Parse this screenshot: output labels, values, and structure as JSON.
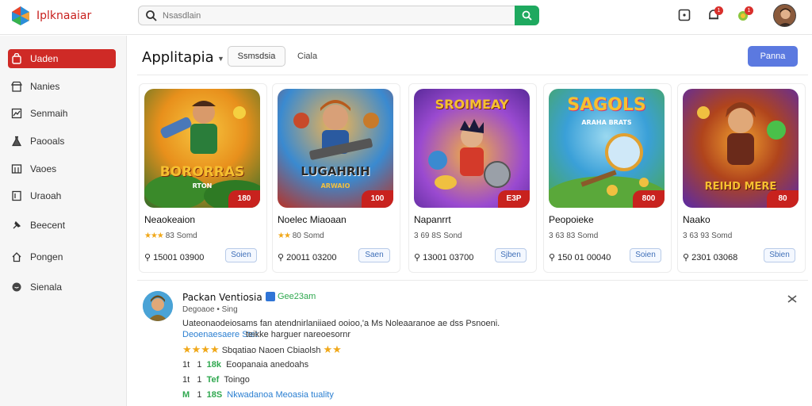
{
  "header": {
    "brand": "Iplknaaiar",
    "search_placeholder": "Nsasdlain",
    "notifications_badge": "1",
    "alerts_badge": "1"
  },
  "sidebar": {
    "items": [
      {
        "label": "Uaden",
        "icon": "bag-icon",
        "active": true
      },
      {
        "label": "Nanies",
        "icon": "store-icon"
      },
      {
        "label": "Senmaih",
        "icon": "chart-icon"
      },
      {
        "label": "Paooals",
        "icon": "flask-icon"
      },
      {
        "label": "Vaoes",
        "icon": "grid-icon"
      },
      {
        "label": "Uraoah",
        "icon": "list-icon"
      },
      {
        "label": "Beecent",
        "icon": "pin-icon"
      },
      {
        "label": "Pongen",
        "icon": "home-icon"
      },
      {
        "label": "Sienala",
        "icon": "chat-icon"
      }
    ]
  },
  "main": {
    "title": "Applitapia",
    "filter_label": "Ssmsdsia",
    "link_label": "Ciala",
    "primary_label": "Panna"
  },
  "cards": [
    {
      "title": "BORORRAS",
      "subtitle": "RTON",
      "price": "180",
      "name": "Neaokeaion",
      "stars": "★★★",
      "rating": "83",
      "rating_label": "Somd",
      "downloads": "15001 03900",
      "button": "Soien",
      "colors": [
        "#e8a01c",
        "#2f7d2a"
      ]
    },
    {
      "title": "LUGAHRIH",
      "subtitle": "ARWAIO",
      "price": "100",
      "name": "Noelec Miaoaan",
      "stars": "★★",
      "rating": "80",
      "rating_label": "Somd",
      "downloads": "20011 03200",
      "button": "Saen",
      "colors": [
        "#2f7fcf",
        "#c0392b"
      ]
    },
    {
      "title": "SROIMEAY",
      "subtitle": "",
      "price": "E3P",
      "name": "Napanrrt",
      "stars": "",
      "rating": "3 69 8S",
      "rating_label": "Sond",
      "downloads": "13001 03700",
      "button": "Sjben",
      "colors": [
        "#7a3fc4",
        "#f08a1c"
      ]
    },
    {
      "title": "SAGOLS",
      "subtitle": "ARAHA BRATS",
      "price": "800",
      "name": "Peopoieke",
      "stars": "",
      "rating": "3 63 83",
      "rating_label": "Somd",
      "downloads": "150 01 00040",
      "button": "Soien",
      "colors": [
        "#2aa4d8",
        "#4db84f"
      ]
    },
    {
      "title": "REIHD MERE",
      "subtitle": "",
      "price": "80",
      "name": "Naako",
      "stars": "",
      "rating": "3 63 93",
      "rating_label": "Somd",
      "downloads": "2301 03068",
      "button": "Sbien",
      "colors": [
        "#6a2fbf",
        "#e06a1c"
      ]
    }
  ],
  "review": {
    "name": "Packan Ventiosia",
    "tag": "Gee23am",
    "subtitle": "Degoaoe • Sing",
    "body": "Uateonaodeiosams fan atendnirlaniiaed ooioo,'a Ms Noleaaranoe ae dss Psnoeni.",
    "link": "Deoenaesaere Stet",
    "link_suffix": "teikke harguer nareoesornr",
    "stars_text": "Sbqatiao Naoen Cbiaolsh",
    "stats": [
      {
        "prefix": "1t",
        "count": "1",
        "value": "18k",
        "label": "Eoopanaia anedoahs"
      },
      {
        "prefix": "1t",
        "count": "1",
        "value": "Tef",
        "label": "Toingo"
      },
      {
        "prefix": "M",
        "count": "1",
        "value": "18S",
        "label": "Nkwadanoa Meoasia tuality"
      }
    ]
  }
}
